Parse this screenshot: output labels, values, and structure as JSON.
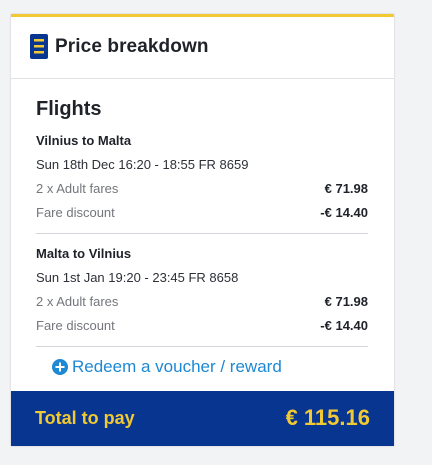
{
  "header": {
    "title": "Price breakdown",
    "icon": "receipt-icon"
  },
  "flights": {
    "section_title": "Flights",
    "legs": [
      {
        "route": "Vilnius to Malta",
        "schedule": "Sun 18th Dec 16:20 - 18:55 FR 8659",
        "fares_label": "2 x Adult fares",
        "fares_value": "€ 71.98",
        "discount_label": "Fare discount",
        "discount_value": "-€ 14.40"
      },
      {
        "route": "Malta to Vilnius",
        "schedule": "Sun 1st Jan 19:20 - 23:45 FR 8658",
        "fares_label": "2 x Adult fares",
        "fares_value": "€ 71.98",
        "discount_label": "Fare discount",
        "discount_value": "-€ 14.40"
      }
    ]
  },
  "voucher": {
    "label": "Redeem a voucher / reward",
    "icon": "plus-circle-icon"
  },
  "total": {
    "label": "Total to pay",
    "value": "€ 115.16"
  },
  "colors": {
    "accent": "#f1c933",
    "brand_blue": "#073590",
    "link_blue": "#1d88d4"
  }
}
